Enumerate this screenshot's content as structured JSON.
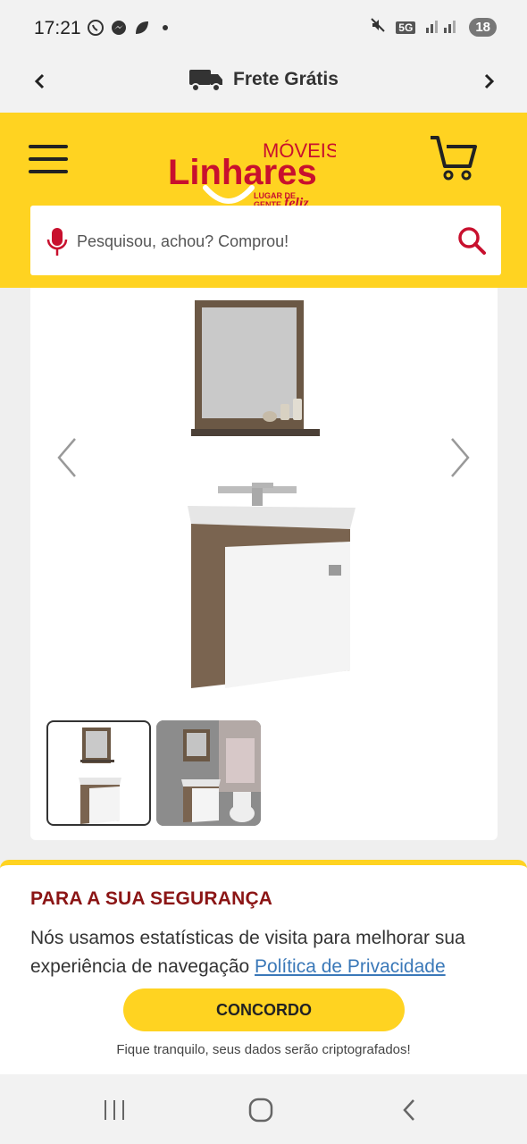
{
  "status_bar": {
    "time": "17:21",
    "apps": [
      "whatsapp-icon",
      "messenger-icon",
      "leaf-icon",
      "dot-icon"
    ],
    "network": "5G",
    "battery": "18"
  },
  "shipping": {
    "label": "Frete Grátis"
  },
  "header": {
    "brand_top": "MÓVEIS",
    "brand_main": "Linhares",
    "tagline_1": "LUGAR DE",
    "tagline_2": "GENTE",
    "tagline_3": "feliz"
  },
  "search": {
    "placeholder": "Pesquisou, achou? Comprou!"
  },
  "cookie": {
    "title": "PARA A SUA SEGURANÇA",
    "text": "Nós usamos estatísticas de visita para melhorar sua experiência de navegação",
    "link": "Política de Privacidade",
    "button": "CONCORDO",
    "note": "Fique tranquilo, seus dados serão criptografados!"
  },
  "colors": {
    "brand_yellow": "#ffd321",
    "brand_red": "#c8102e",
    "title_red": "#8b1515",
    "link_blue": "#3a78b8"
  }
}
